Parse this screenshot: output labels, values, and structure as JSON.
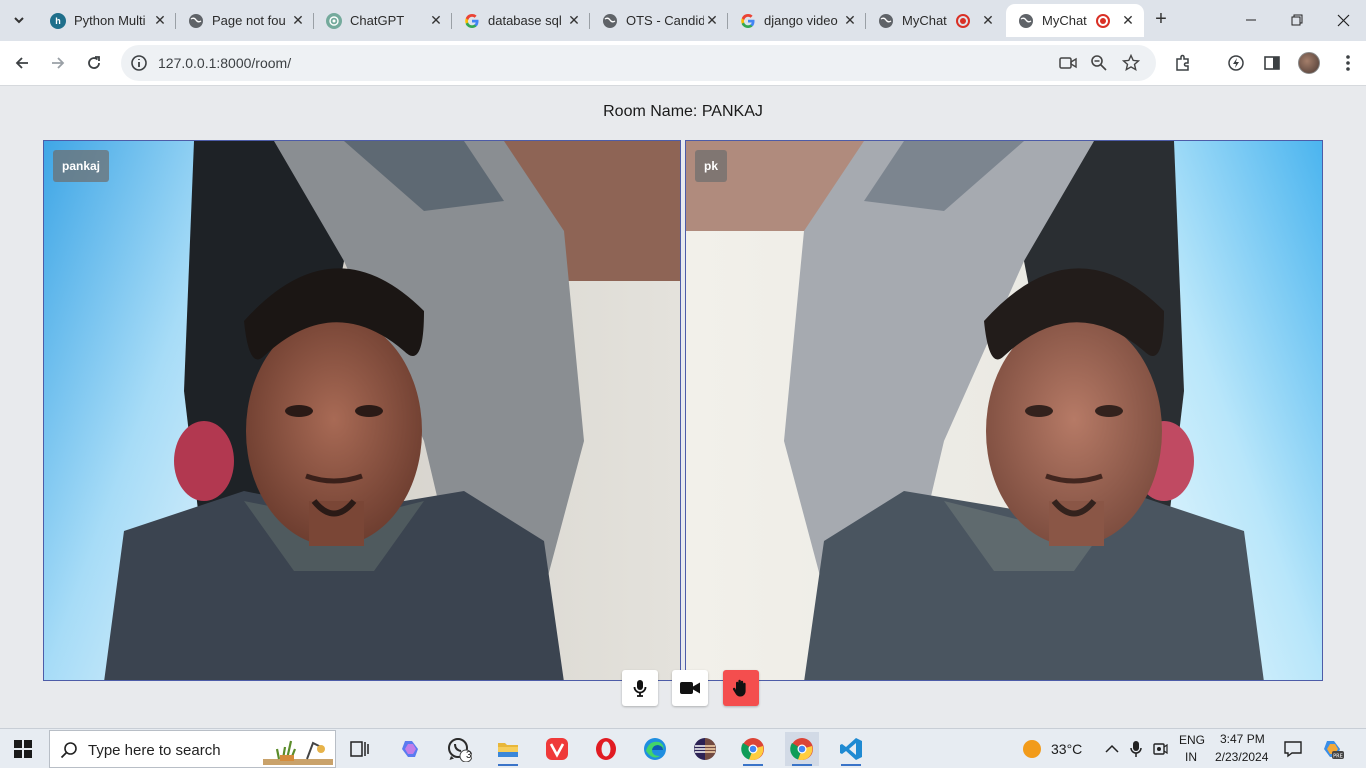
{
  "browser": {
    "tabs": [
      {
        "title": "Python Multi",
        "favicon": "python-tab-icon",
        "close": "✕"
      },
      {
        "title": "Page not fou",
        "favicon": "globe-icon",
        "close": "✕"
      },
      {
        "title": "ChatGPT",
        "favicon": "chatgpt-icon",
        "close": "✕"
      },
      {
        "title": "database sql",
        "favicon": "google-icon",
        "close": "✕"
      },
      {
        "title": "OTS - Candid",
        "favicon": "globe-icon",
        "close": "✕"
      },
      {
        "title": "django video",
        "favicon": "google-icon",
        "close": "✕"
      },
      {
        "title": "MyChat",
        "favicon": "globe-icon",
        "close": "✕",
        "recording": true
      },
      {
        "title": "MyChat",
        "favicon": "globe-icon",
        "close": "✕",
        "recording": true,
        "active": true
      }
    ],
    "new_tab": "+",
    "url": "127.0.0.1:8000/room/"
  },
  "room": {
    "title": "Room Name: PANKAJ",
    "participants": [
      {
        "name": "pankaj"
      },
      {
        "name": "pk"
      }
    ]
  },
  "controls": {
    "mic": "microphone-icon",
    "camera": "video-camera-icon",
    "leave": "hand-icon",
    "leave_color": "#f44e4e"
  },
  "taskbar": {
    "search_placeholder": "Type here to search",
    "whatsapp_badge": "3",
    "temperature": "33°C",
    "language_line1": "ENG",
    "language_line2": "IN",
    "time": "3:47 PM",
    "date": "2/23/2024"
  }
}
